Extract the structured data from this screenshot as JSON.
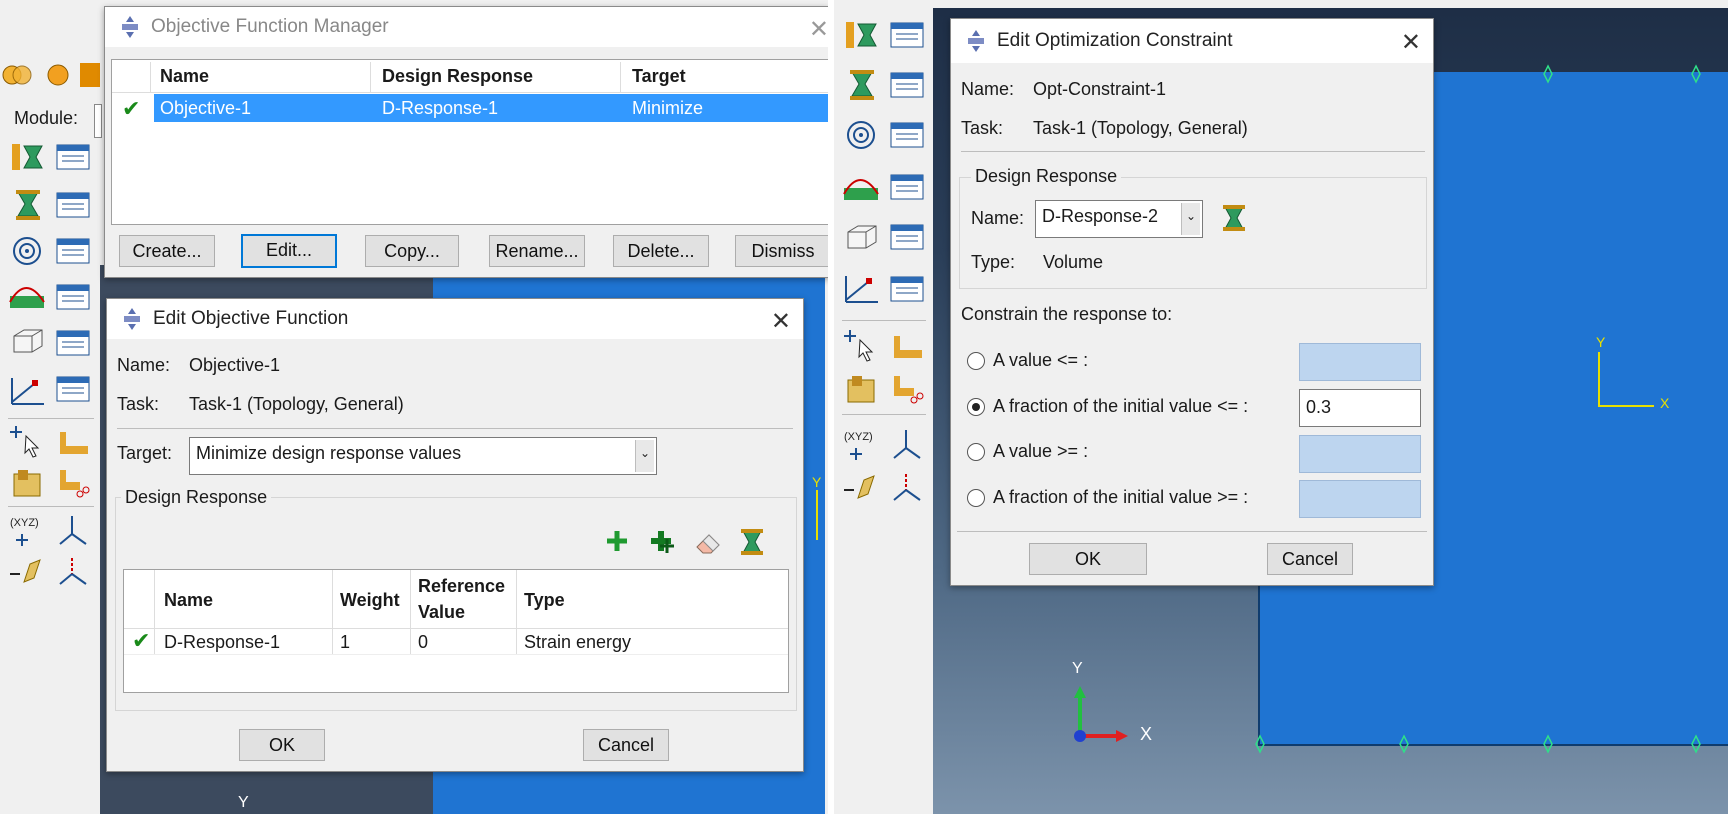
{
  "left_side": {
    "module_label": "Module:",
    "obj_manager": {
      "title": "Objective Function Manager",
      "columns": [
        "Name",
        "Design Response",
        "Target"
      ],
      "rows": [
        {
          "name": "Objective-1",
          "design_response": "D-Response-1",
          "target": "Minimize",
          "status": "check"
        }
      ],
      "buttons": {
        "create": "Create...",
        "edit": "Edit...",
        "copy": "Copy...",
        "rename": "Rename...",
        "delete": "Delete...",
        "dismiss": "Dismiss"
      }
    },
    "edit_objective": {
      "title": "Edit Objective Function",
      "name_label": "Name:",
      "name_value": "Objective-1",
      "task_label": "Task:",
      "task_value": "Task-1 (Topology, General)",
      "target_label": "Target:",
      "target_value": "Minimize design response values",
      "group_title": "Design Response",
      "columns": {
        "name": "Name",
        "weight": "Weight",
        "reference_1": "Reference",
        "reference_2": "Value",
        "type": "Type"
      },
      "rows": [
        {
          "name": "D-Response-1",
          "weight": "1",
          "reference_value": "0",
          "type": "Strain energy"
        }
      ],
      "ok": "OK",
      "cancel": "Cancel"
    },
    "axis_label_y": "Y"
  },
  "right_side": {
    "edit_constraint": {
      "title": "Edit Optimization Constraint",
      "name_label": "Name:",
      "name_value": "Opt-Constraint-1",
      "task_label": "Task:",
      "task_value": "Task-1 (Topology, General)",
      "group_title": "Design Response",
      "resp_name_label": "Name:",
      "resp_name_value": "D-Response-2",
      "type_label": "Type:",
      "type_value": "Volume",
      "constrain_label": "Constrain the response to:",
      "options": [
        {
          "label": "A value <= :",
          "selected": false,
          "value": ""
        },
        {
          "label": "A fraction of the initial value <= :",
          "selected": true,
          "value": "0.3"
        },
        {
          "label": "A value >= :",
          "selected": false,
          "value": ""
        },
        {
          "label": "A fraction of the initial value >= :",
          "selected": false,
          "value": ""
        }
      ],
      "ok": "OK",
      "cancel": "Cancel"
    },
    "triad_small": {
      "y": "Y",
      "x": "X"
    },
    "triad_large": {
      "y": "Y",
      "x": "X"
    }
  },
  "colors": {
    "selection": "#3399ff",
    "viewport_blue": "#1f74d2",
    "field_blue": "#bdd5ef"
  }
}
